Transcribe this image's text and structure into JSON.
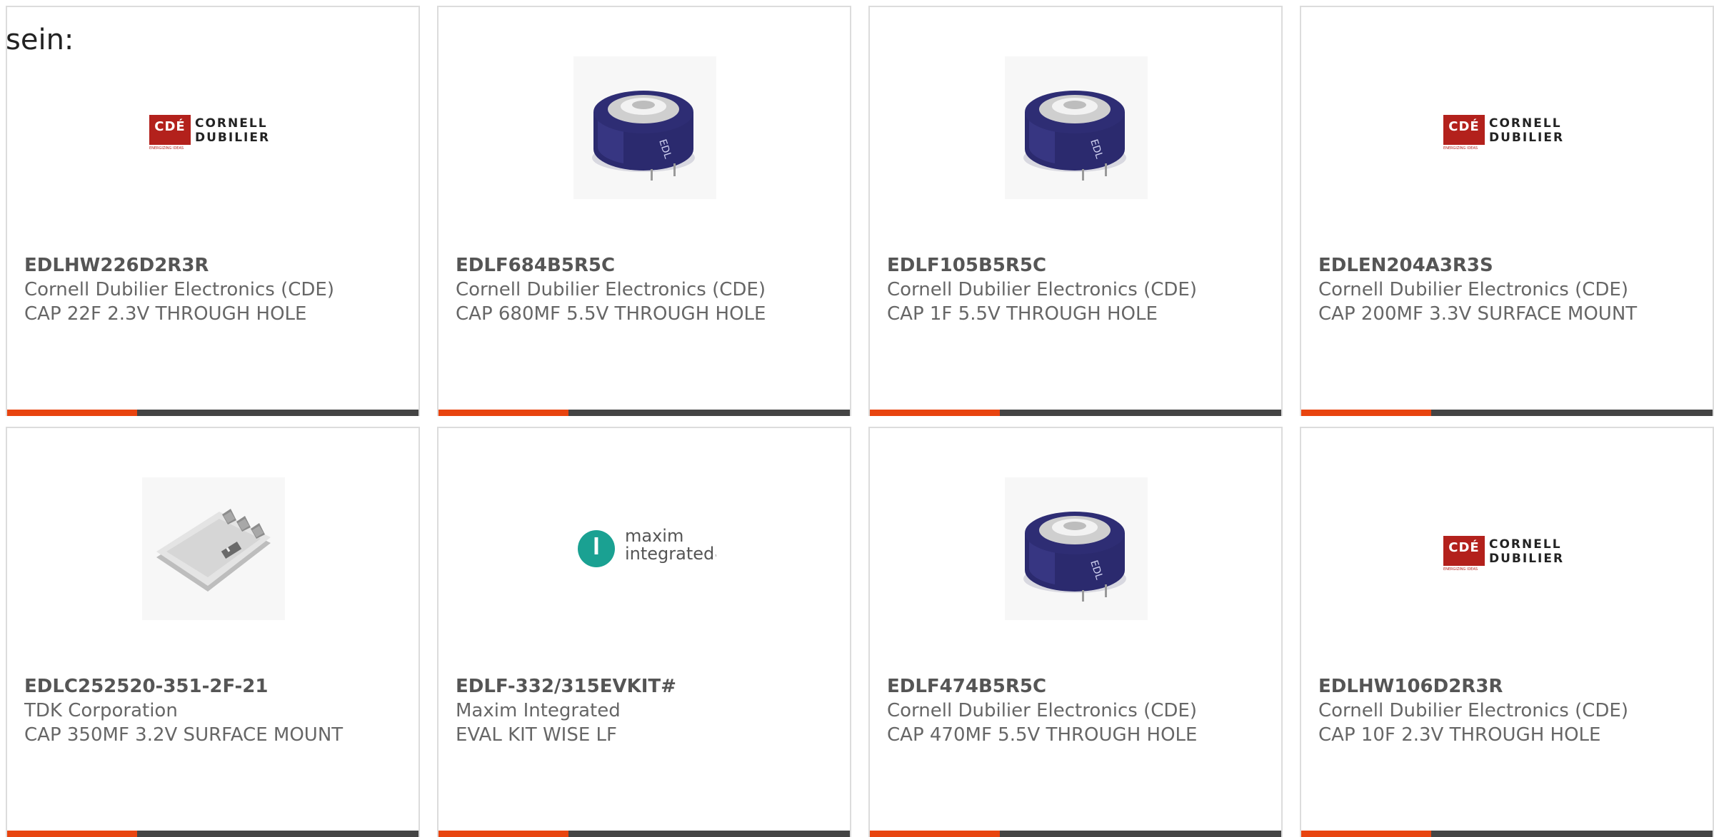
{
  "intro_text": "sein:",
  "cde_logo": {
    "abbr": "CDÉ",
    "name_line1": "CORNELL",
    "name_line2": "DUBILIER",
    "tagline": "ENERGIZING IDEAS"
  },
  "maxim_logo": {
    "line1": "maxim",
    "line2": "integrated",
    "tm": "™"
  },
  "colors": {
    "accent": "#e8440f",
    "bar": "#444444",
    "cde_red": "#b3211c",
    "maxim_teal": "#1aa192",
    "capacitor_body": "#2b2a6e"
  },
  "products": [
    {
      "part_number": "EDLHW226D2R3R",
      "manufacturer": "Cornell Dubilier Electronics (CDE)",
      "description": "CAP 22F 2.3V THROUGH HOLE",
      "image": "cde-logo"
    },
    {
      "part_number": "EDLF684B5R5C",
      "manufacturer": "Cornell Dubilier Electronics (CDE)",
      "description": "CAP 680MF 5.5V THROUGH HOLE",
      "image": "radial-supercapacitor"
    },
    {
      "part_number": "EDLF105B5R5C",
      "manufacturer": "Cornell Dubilier Electronics (CDE)",
      "description": "CAP 1F 5.5V THROUGH HOLE",
      "image": "radial-supercapacitor"
    },
    {
      "part_number": "EDLEN204A3R3S",
      "manufacturer": "Cornell Dubilier Electronics (CDE)",
      "description": "CAP 200MF 3.3V SURFACE MOUNT",
      "image": "cde-logo"
    },
    {
      "part_number": "EDLC252520-351-2F-21",
      "manufacturer": "TDK Corporation",
      "description": "CAP 350MF 3.2V SURFACE MOUNT",
      "image": "flat-pouch-capacitor"
    },
    {
      "part_number": "EDLF-332/315EVKIT#",
      "manufacturer": "Maxim Integrated",
      "description": "EVAL KIT WISE LF",
      "image": "maxim-logo"
    },
    {
      "part_number": "EDLF474B5R5C",
      "manufacturer": "Cornell Dubilier Electronics (CDE)",
      "description": "CAP 470MF 5.5V THROUGH HOLE",
      "image": "radial-supercapacitor"
    },
    {
      "part_number": "EDLHW106D2R3R",
      "manufacturer": "Cornell Dubilier Electronics (CDE)",
      "description": "CAP 10F 2.3V THROUGH HOLE",
      "image": "cde-logo"
    }
  ]
}
